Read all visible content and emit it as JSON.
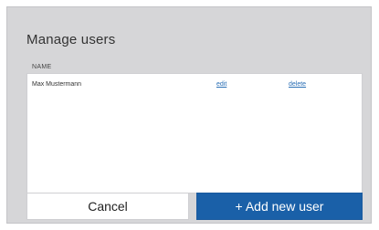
{
  "dialog": {
    "title": "Manage users",
    "table": {
      "columns": [
        "NAME"
      ],
      "rows": [
        {
          "name": "Max Mustermann",
          "edit_label": "edit",
          "delete_label": "delete"
        }
      ]
    },
    "buttons": {
      "cancel_label": "Cancel",
      "add_label": "+ Add new user"
    }
  },
  "colors": {
    "dialog_background": "#d6d6d8",
    "primary_button": "#1a60a8",
    "link": "#2a6fb5"
  }
}
